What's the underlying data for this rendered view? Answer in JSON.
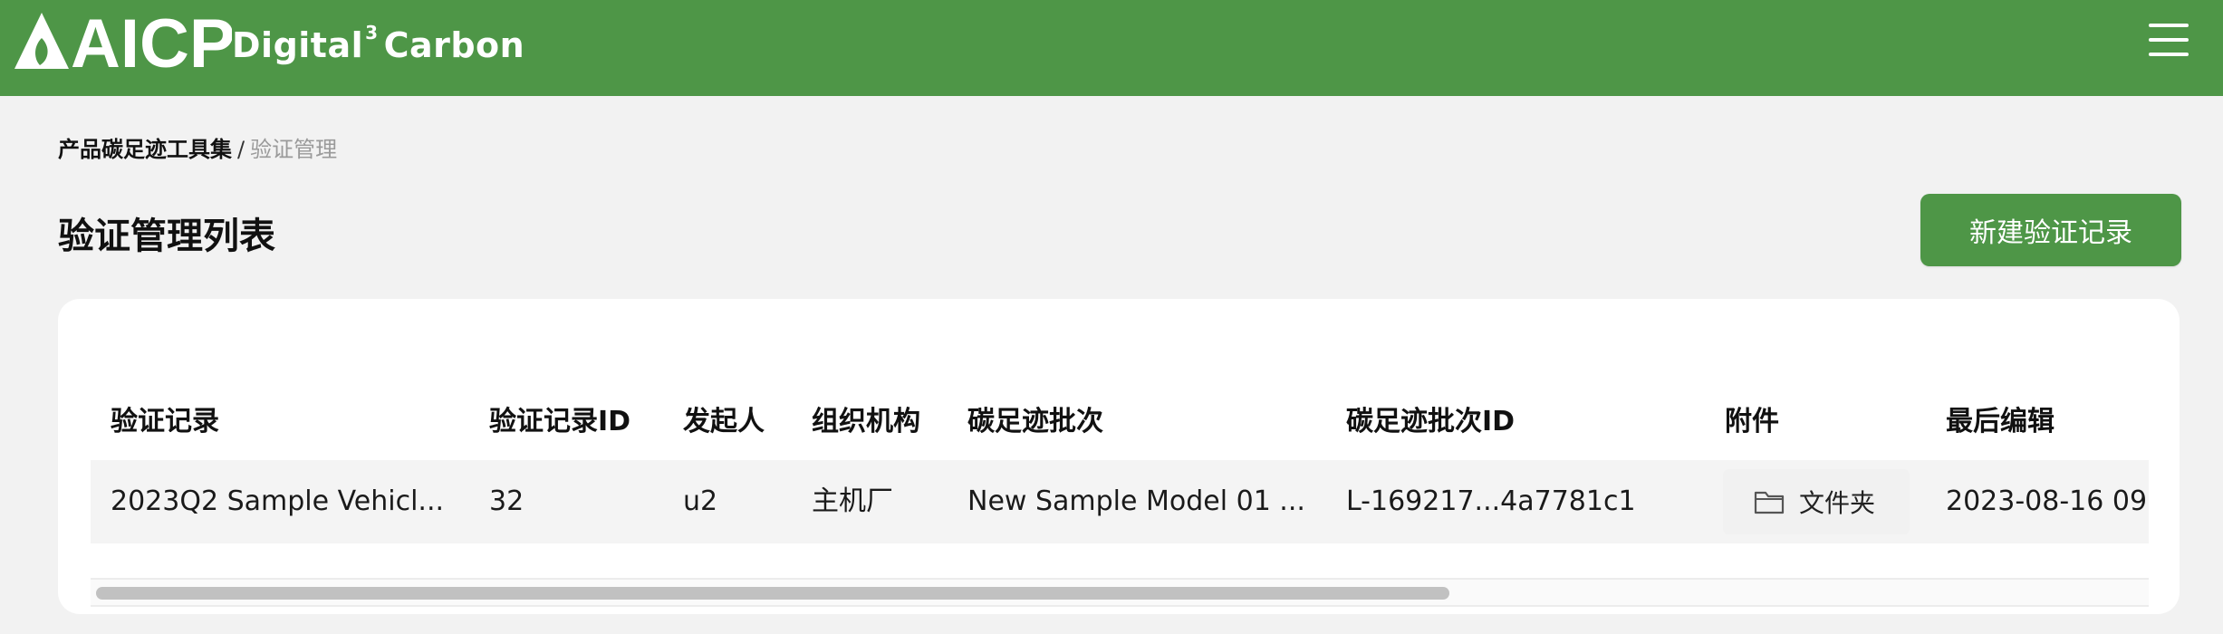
{
  "header": {
    "logo_text": "AICP",
    "brand_main": "Digital",
    "brand_sup": "3",
    "brand_tail": "Carbon",
    "menu_icon": "hamburger-menu-icon",
    "color": "#4e9647"
  },
  "breadcrumb": {
    "parent": "产品碳足迹工具集",
    "separator": "/",
    "current": "验证管理"
  },
  "page": {
    "title": "验证管理列表",
    "new_button": "新建验证记录"
  },
  "table": {
    "columns": [
      "验证记录",
      "验证记录ID",
      "发起人",
      "组织机构",
      "碳足迹批次",
      "碳足迹批次ID",
      "附件",
      "最后编辑"
    ],
    "rows": [
      {
        "record": "2023Q2 Sample Vehicl...",
        "record_id": "32",
        "initiator": "u2",
        "org": "主机厂",
        "batch": "New Sample Model 01 ...",
        "batch_id": "L-169217...4a7781c1",
        "attachment_label": "文件夹",
        "attachment_icon": "folder-icon",
        "last_edit": "2023-08-16 09:"
      }
    ]
  }
}
